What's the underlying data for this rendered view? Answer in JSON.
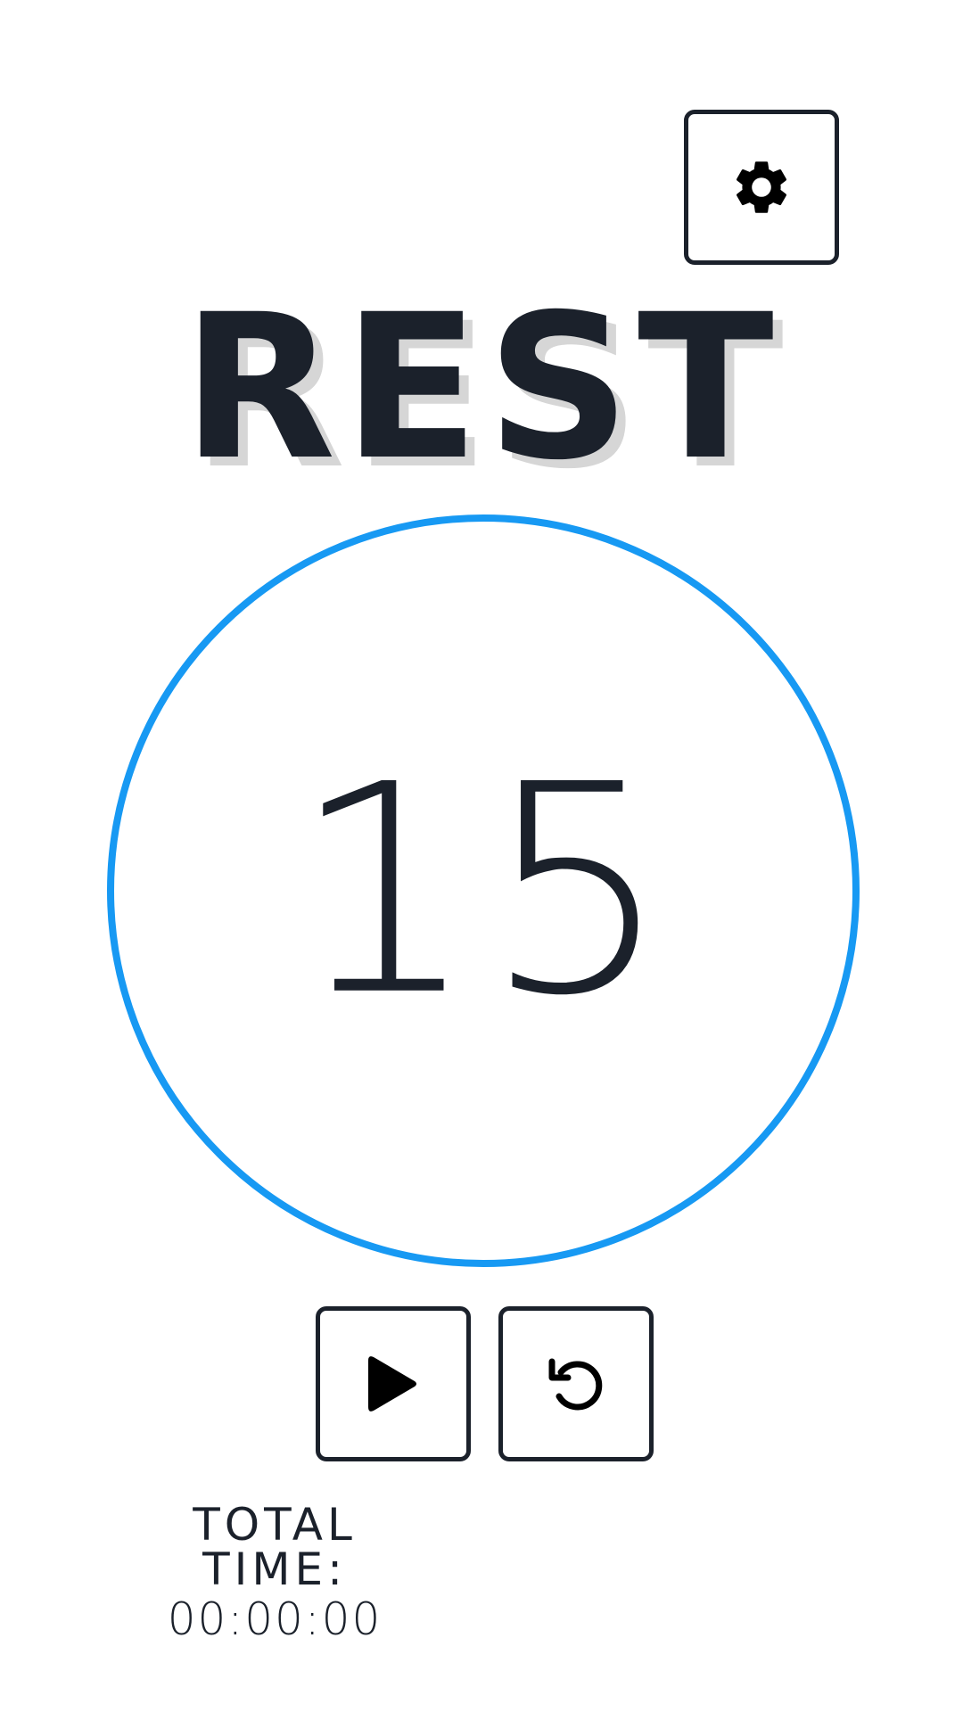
{
  "header": {
    "settings_icon": "gear-icon"
  },
  "phase": {
    "label": "REST"
  },
  "timer": {
    "countdown": "15",
    "ring_color": "#1799f3"
  },
  "controls": {
    "play_icon": "play-icon",
    "reset_icon": "restart-icon"
  },
  "total": {
    "label": "TOTAL TIME:",
    "value": "00:00:00"
  },
  "colors": {
    "text": "#1b212b",
    "accent": "#1799f3",
    "shadow": "#d6d6d6",
    "background": "#ffffff"
  }
}
